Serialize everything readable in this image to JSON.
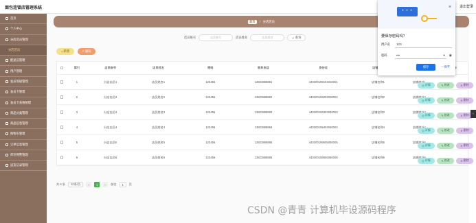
{
  "app": {
    "title": "面包连锁店管理系统",
    "topbar_right": "退出登录"
  },
  "sidebar": {
    "items": [
      {
        "label": "首页",
        "sub": false
      },
      {
        "label": "个人中心",
        "sub": false
      },
      {
        "label": "分店店员管理",
        "sub": false
      },
      {
        "label": "分店店员",
        "sub": true
      },
      {
        "label": "配送员管理",
        "sub": false
      },
      {
        "label": "用户管理",
        "sub": false
      },
      {
        "label": "会员等级管理",
        "sub": false
      },
      {
        "label": "会员卡管理",
        "sub": false
      },
      {
        "label": "会员卡充值管理",
        "sub": false
      },
      {
        "label": "商品分类管理",
        "sub": false
      },
      {
        "label": "商品信息管理",
        "sub": false
      },
      {
        "label": "购物车管理",
        "sub": false
      },
      {
        "label": "订单信息管理",
        "sub": false
      },
      {
        "label": "库存预警管理",
        "sub": false
      },
      {
        "label": "送货记录管理",
        "sub": false
      }
    ]
  },
  "breadcrumb": {
    "home": "首页",
    "sep": "/",
    "current": "分店店员"
  },
  "search": {
    "label1": "店员账号",
    "placeholder1": "店员账号",
    "label2": "店员姓名",
    "placeholder2": "店员姓名",
    "button": "查询"
  },
  "actions": {
    "add": "新增",
    "delete": "删除"
  },
  "table": {
    "headers": [
      "索引",
      "店员账号",
      "店员姓名",
      "密码",
      "联系电话",
      "身份证",
      "店铺名称",
      "店铺地址",
      "操作"
    ],
    "rows": [
      [
        "1",
        "分店店员1",
        "店员姓名1",
        "123456",
        "13823888881",
        "440300199101010001",
        "店铺名称1",
        "店铺地址1"
      ],
      [
        "2",
        "分店店员2",
        "店员姓名2",
        "123456",
        "13823888882",
        "440300199202020002",
        "店铺名称2",
        "店铺地址2"
      ],
      [
        "3",
        "分店店员3",
        "店员姓名3",
        "123456",
        "13823888883",
        "440300199303030003",
        "店铺名称3",
        "店铺地址3"
      ],
      [
        "4",
        "分店店员4",
        "店员姓名4",
        "123456",
        "13823888884",
        "440300199404040004",
        "店铺名称4",
        "店铺地址4"
      ],
      [
        "5",
        "分店店员5",
        "店员姓名5",
        "123456",
        "13823888885",
        "440300199505050005",
        "店铺名称5",
        "店铺地址5"
      ],
      [
        "6",
        "分店店员6",
        "店员姓名6",
        "123456",
        "13823888886",
        "440300199606060006",
        "店铺名称6",
        "店铺地址6"
      ]
    ],
    "op_view": "详情",
    "op_edit": "修改",
    "op_delete": "删除"
  },
  "pager": {
    "total": "共 6 条",
    "size": "10条/页",
    "prev": "<",
    "current": "1",
    "next": ">",
    "goto": "前往",
    "page_input": "1",
    "unit": "页"
  },
  "popup": {
    "card_text": "* * *",
    "close": "×",
    "title": "要保存密码吗？",
    "username_label": "用户名",
    "username_value": "123",
    "password_label": "密码",
    "password_value": "•••",
    "save": "保存",
    "never": "一律不"
  },
  "edge_tab": "‹",
  "watermark": "CSDN @青青  计算机毕设源码程序",
  "colors": {
    "sidebar": "#8a6e5e",
    "breadcrumb": "#a88370",
    "accent_blue": "#1a73e8",
    "page_current": "#4caf50"
  }
}
